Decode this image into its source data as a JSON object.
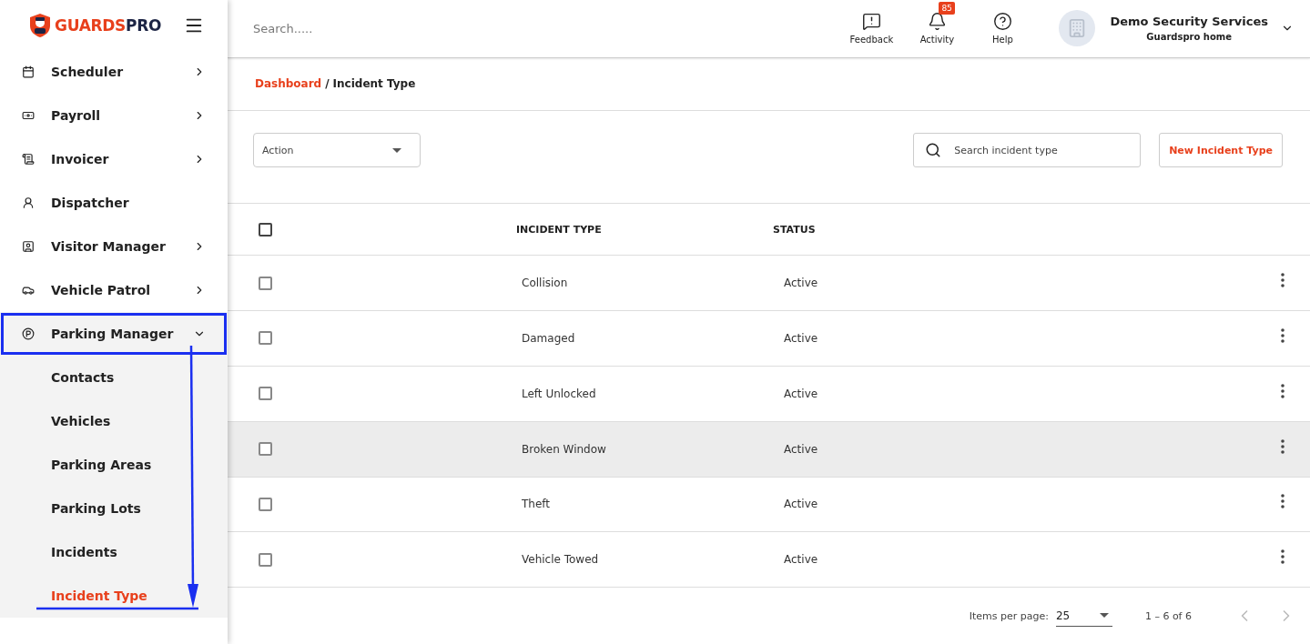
{
  "logo": {
    "first": "GUARDS",
    "second": "PRO"
  },
  "sidebar": {
    "items": [
      {
        "label": "Scheduler",
        "has_arrow": true,
        "expanded": false,
        "highlighted": false
      },
      {
        "label": "Payroll",
        "has_arrow": true,
        "expanded": false,
        "highlighted": false
      },
      {
        "label": "Invoicer",
        "has_arrow": true,
        "expanded": false,
        "highlighted": false
      },
      {
        "label": "Dispatcher",
        "has_arrow": false,
        "expanded": false,
        "highlighted": false
      },
      {
        "label": "Visitor Manager",
        "has_arrow": true,
        "expanded": false,
        "highlighted": false
      },
      {
        "label": "Vehicle Patrol",
        "has_arrow": true,
        "expanded": false,
        "highlighted": false
      },
      {
        "label": "Parking Manager",
        "has_arrow": true,
        "expanded": true,
        "highlighted": true,
        "children": [
          {
            "label": "Contacts",
            "selected": false
          },
          {
            "label": "Vehicles",
            "selected": false
          },
          {
            "label": "Parking Areas",
            "selected": false
          },
          {
            "label": "Parking Lots",
            "selected": false
          },
          {
            "label": "Incidents",
            "selected": false
          },
          {
            "label": "Incident Type",
            "selected": true
          }
        ]
      }
    ]
  },
  "header": {
    "search": {
      "placeholder": "Search....."
    },
    "actions": [
      {
        "label": "Feedback"
      },
      {
        "label": "Activity",
        "badge": "85"
      },
      {
        "label": "Help"
      }
    ],
    "account": {
      "name": "Demo Security Services",
      "subtitle": "Guardspro home"
    }
  },
  "breadcrumb": {
    "link": "Dashboard",
    "separator": "/",
    "current": "Incident Type"
  },
  "toolbar": {
    "action_select": "Action",
    "search": {
      "placeholder": "Search incident type"
    },
    "new_button": "New Incident Type"
  },
  "table": {
    "select_all": {
      "checked": false
    },
    "columns": [
      "INCIDENT TYPE",
      "STATUS"
    ],
    "rows": [
      {
        "checked": false,
        "hovered": false,
        "cells": [
          "Collision",
          "Active"
        ]
      },
      {
        "checked": false,
        "hovered": false,
        "cells": [
          "Damaged",
          "Active"
        ]
      },
      {
        "checked": false,
        "hovered": false,
        "cells": [
          "Left Unlocked",
          "Active"
        ]
      },
      {
        "checked": false,
        "hovered": true,
        "cells": [
          "Broken Window",
          "Active"
        ]
      },
      {
        "checked": false,
        "hovered": false,
        "cells": [
          "Theft",
          "Active"
        ]
      },
      {
        "checked": false,
        "hovered": false,
        "cells": [
          "Vehicle Towed",
          "Active"
        ]
      }
    ]
  },
  "paginator": {
    "label": "Items per page:",
    "page_size": "25",
    "range": "1 – 6 of 6"
  }
}
